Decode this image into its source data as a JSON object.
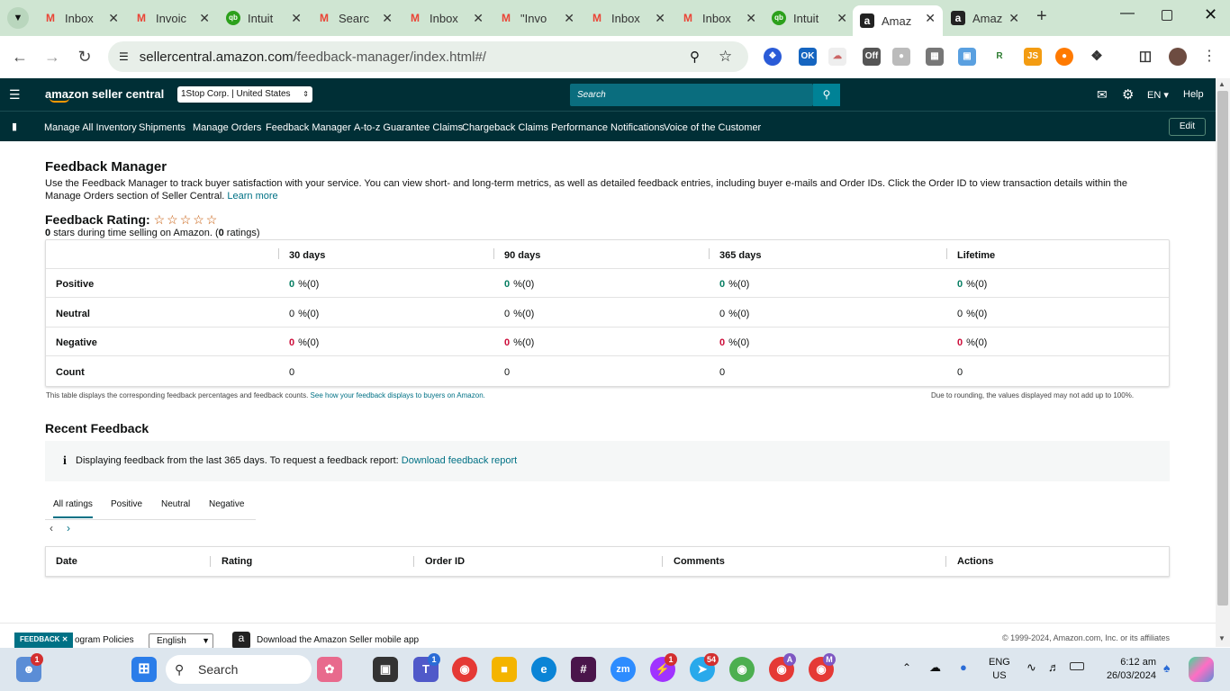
{
  "browser": {
    "tabs": [
      {
        "label": "Inbox",
        "icon": "gmail-icon"
      },
      {
        "label": "Invoic",
        "icon": "gmail-icon"
      },
      {
        "label": "Intuit",
        "icon": "quickbooks-icon"
      },
      {
        "label": "Searc",
        "icon": "gmail-icon"
      },
      {
        "label": "Inbox",
        "icon": "gmail-icon"
      },
      {
        "label": "\"Invo",
        "icon": "gmail-icon"
      },
      {
        "label": "Inbox",
        "icon": "gmail-icon"
      },
      {
        "label": "Inbox",
        "icon": "gmail-icon"
      },
      {
        "label": "Intuit",
        "icon": "quickbooks-icon"
      },
      {
        "label": "Amaz",
        "icon": "amazon-icon"
      },
      {
        "label": "Amaz",
        "icon": "amazon-icon"
      }
    ],
    "url_host": "sellercentral.amazon.com",
    "url_path": "/feedback-manager/index.html#/",
    "ext_ok": "OK",
    "ext_off": "Off"
  },
  "seller": {
    "logo": "amazon seller central",
    "account": "1Stop Corp. | United States",
    "search_placeholder": "Search",
    "lang": "EN",
    "help": "Help",
    "nav": [
      "Manage All Inventory",
      "Shipments",
      "Manage Orders",
      "Feedback Manager",
      "A-to-z Guarantee Claims",
      "Chargeback Claims",
      "Performance Notifications",
      "Voice of the Customer"
    ],
    "edit": "Edit"
  },
  "page": {
    "title": "Feedback Manager",
    "description": "Use the Feedback Manager to track buyer satisfaction with your service. You can view short- and long-term metrics, as well as detailed feedback entries, including buyer e-mails and Order IDs. Click the Order ID to view transaction details within the Manage Orders section of Seller Central.",
    "learn_more": "Learn more",
    "rating_label": "Feedback Rating:",
    "stars_value": "0",
    "stars_text": "stars during time selling on Amazon. (",
    "ratings_count": "0",
    "ratings_text": "ratings)",
    "table_headers": [
      "30 days",
      "90 days",
      "365 days",
      "Lifetime"
    ],
    "rows": [
      {
        "label": "Positive",
        "values": [
          "0",
          "0",
          "0",
          "0"
        ],
        "suffix": "%(0)"
      },
      {
        "label": "Neutral",
        "values": [
          "0",
          "0",
          "0",
          "0"
        ],
        "suffix": "%(0)"
      },
      {
        "label": "Negative",
        "values": [
          "0",
          "0",
          "0",
          "0"
        ],
        "suffix": "%(0)"
      },
      {
        "label": "Count",
        "values": [
          "0",
          "0",
          "0",
          "0"
        ],
        "suffix": ""
      }
    ],
    "table_note": "This table displays the corresponding feedback percentages and feedback counts.",
    "table_note_link": "See how your feedback displays to buyers on Amazon.",
    "rounding_note": "Due to rounding, the values displayed may not add up to 100%.",
    "recent_title": "Recent Feedback",
    "info_text": "Displaying feedback from the last 365 days. To request a feedback report:",
    "info_link": "Download feedback report",
    "filter_tabs": [
      "All ratings",
      "Positive",
      "Neutral",
      "Negative"
    ],
    "recent_headers": [
      "Date",
      "Rating",
      "Order ID",
      "Comments",
      "Actions"
    ]
  },
  "footer": {
    "feedback_btn": "FEEDBACK",
    "policies": "ogram Policies",
    "language": "English",
    "app_text": "Download the Amazon Seller mobile app",
    "copyright": "© 1999-2024, Amazon.com, Inc. or its affiliates"
  },
  "taskbar": {
    "search": "Search",
    "lang1": "ENG",
    "lang2": "US",
    "time": "6:12 am",
    "date": "26/03/2024",
    "badge_people": "1",
    "badge_teams": "1",
    "badge_messenger": "1",
    "badge_telegram": "54",
    "avatar_a": "A",
    "avatar_m": "M",
    "zoom": "zm"
  }
}
